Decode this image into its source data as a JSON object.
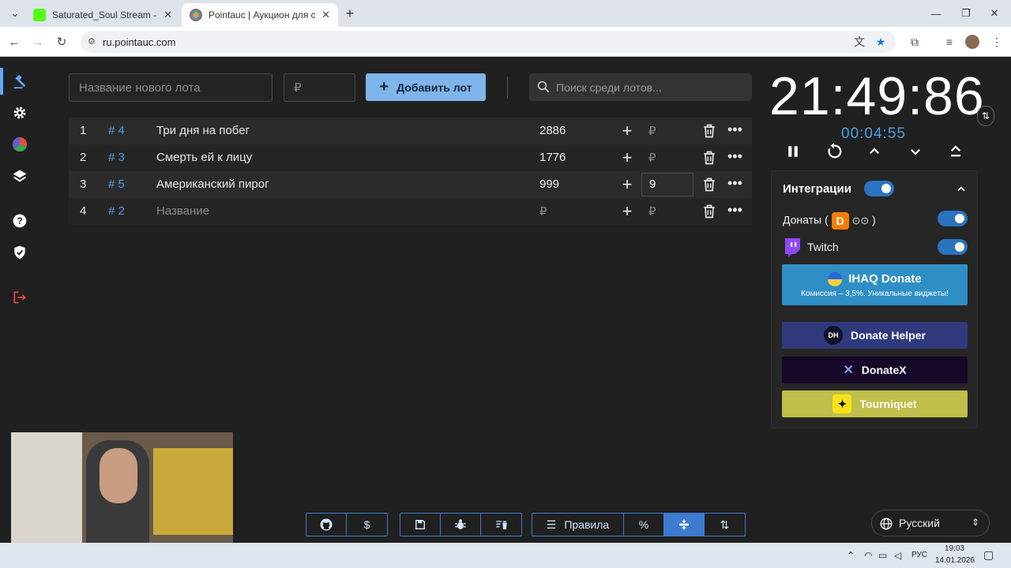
{
  "browser": {
    "tabs": [
      {
        "title": "Saturated_Soul Stream - Watch",
        "active": false
      },
      {
        "title": "Pointauc | Аукцион для стриме",
        "active": true
      }
    ],
    "new_tab": "+",
    "url": "ru.pointauc.com"
  },
  "toolbar": {
    "lot_name_placeholder": "Название нового лота",
    "amount_placeholder": "₽",
    "add_button_label": "Добавить лот",
    "search_placeholder": "Поиск среди лотов..."
  },
  "lots": [
    {
      "index": "1",
      "id": "# 4",
      "name": "Три дня на побег",
      "amount": "2886",
      "add_placeholder": "₽"
    },
    {
      "index": "2",
      "id": "# 3",
      "name": "Смерть ей к лицу",
      "amount": "1776",
      "add_placeholder": "₽"
    },
    {
      "index": "3",
      "id": "# 5",
      "name": "Американский пирог",
      "amount": "999",
      "add_value": "9"
    },
    {
      "index": "4",
      "id": "# 2",
      "name": "Название",
      "amount": "₽",
      "add_placeholder": "₽"
    }
  ],
  "timer": {
    "main": "21:49:86",
    "elapsed": "00:04:55"
  },
  "integrations": {
    "title": "Интеграции",
    "donations_label": "Донаты (",
    "donations_suffix": ")",
    "twitch_label": "Twitch",
    "ihaq": {
      "title": "IHAQ Donate",
      "subtitle": "Комиссия – 3,5%. Уникальные виджеты!"
    },
    "services": [
      "Donate Helper",
      "DonateX",
      "Tourniquet"
    ],
    "dh_badge": "DH"
  },
  "bottom_bar": {
    "rules_label": "Правила",
    "percent_label": "%"
  },
  "language": {
    "label": "Русский"
  },
  "taskbar": {
    "lang": "РУС",
    "time": "19:03",
    "date": "14.01.2026"
  },
  "colors": {
    "accent": "#4c9ee8",
    "add_button": "#7fb5ea",
    "toggle": "#2a73c0",
    "ihaq": "#2f8fc4",
    "donate_helper": "#2f3a7d",
    "donatex": "#150828",
    "tourniquet": "#bfbf4a"
  }
}
